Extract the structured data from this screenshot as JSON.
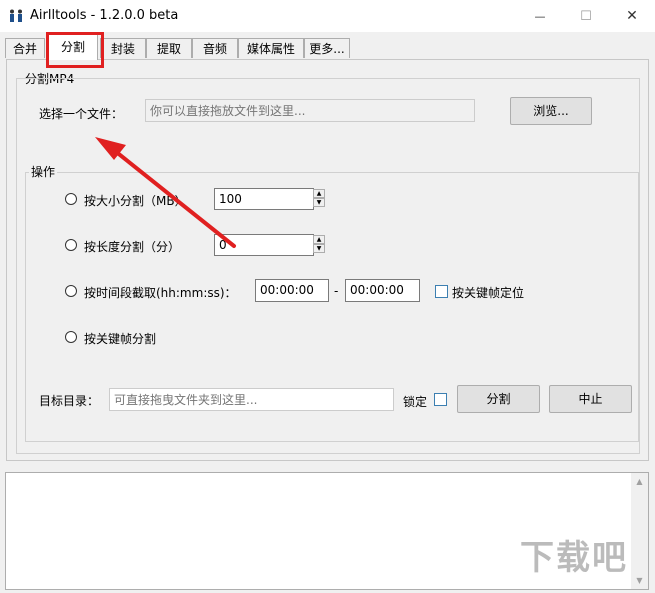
{
  "window": {
    "title": "Airlltools  -  1.2.0.0 beta",
    "minimize_glyph": "—",
    "maximize_glyph": "☐",
    "close_glyph": "✕"
  },
  "tabs": [
    {
      "label": "合并"
    },
    {
      "label": "分割"
    },
    {
      "label": "封装"
    },
    {
      "label": "提取"
    },
    {
      "label": "音频"
    },
    {
      "label": "媒体属性"
    },
    {
      "label": "更多..."
    }
  ],
  "active_tab": "分割",
  "split_panel": {
    "group_title": "分割MP4",
    "file_label": "选择一个文件：",
    "file_placeholder": "你可以直接拖放文件到这里...",
    "browse_label": "浏览..."
  },
  "operation": {
    "group_title": "操作",
    "options": [
      {
        "label": "按大小分割（MB）",
        "value": "100"
      },
      {
        "label": "按长度分割（分）",
        "value": "0"
      },
      {
        "label": "按时间段截取(hh:mm:ss)：",
        "start": "00:00:00",
        "separator": "-",
        "end": "00:00:00",
        "keyframe_label": "按关键帧定位"
      },
      {
        "label": "按关键帧分割"
      }
    ],
    "target_label": "目标目录：",
    "target_placeholder": "可直接拖曳文件夹到这里...",
    "lock_label": "锁定",
    "split_button": "分割",
    "stop_button": "中止"
  },
  "output_log": {
    "text": ""
  },
  "watermark": {
    "text": "下载吧"
  },
  "colors": {
    "annotation_red": "#e02020",
    "checkbox_border": "#3c7fb1"
  }
}
